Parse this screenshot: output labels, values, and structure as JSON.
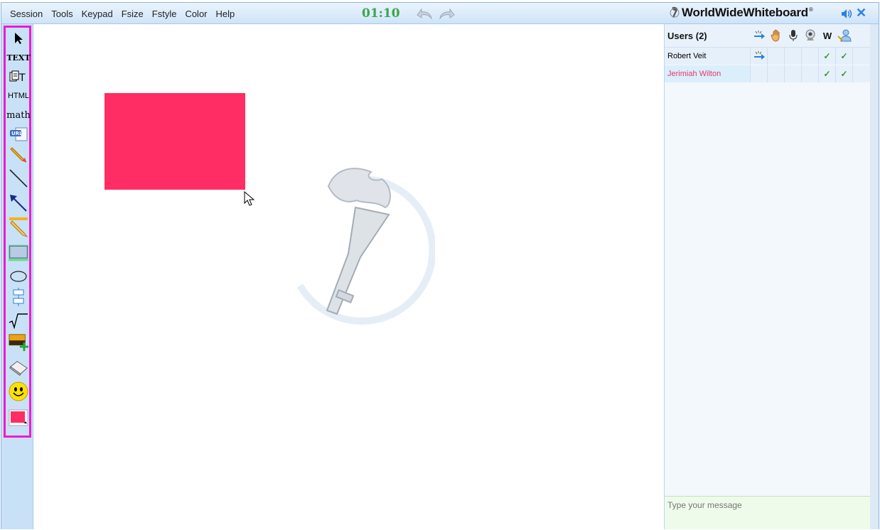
{
  "menu": [
    "Session",
    "Tools",
    "Keypad",
    "Fsize",
    "Fstyle",
    "Color",
    "Help"
  ],
  "timer": "01:10",
  "brand": {
    "name": "WorldWideWhiteboard",
    "reg": "®"
  },
  "toolbar": {
    "text_label": "TEXT",
    "html_label": "HTML",
    "math_label": "math",
    "url_label": "URL"
  },
  "colors": {
    "shape": "#ff2d63",
    "toolbar_border": "#ea1bd6",
    "timer": "#3aa64a"
  },
  "users": {
    "title": "Users (2)",
    "col_w": "W",
    "rows": [
      {
        "name": "Robert Veit",
        "w": "✓",
        "s": "✓"
      },
      {
        "name": "Jerimiah Wilton",
        "w": "✓",
        "s": "✓"
      }
    ]
  },
  "chat": {
    "placeholder": "Type your message"
  }
}
